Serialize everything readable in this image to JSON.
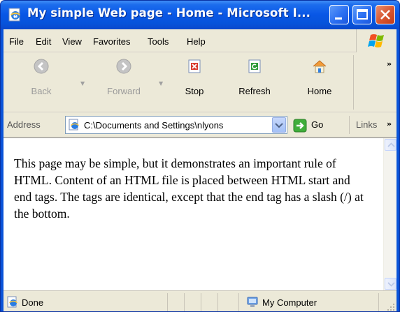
{
  "window": {
    "title": "My simple Web page - Home - Microsoft I..."
  },
  "menu": {
    "items": [
      "File",
      "Edit",
      "View",
      "Favorites",
      "Tools",
      "Help"
    ]
  },
  "toolbar": {
    "back_label": "Back",
    "forward_label": "Forward",
    "stop_label": "Stop",
    "refresh_label": "Refresh",
    "home_label": "Home",
    "overflow": "»"
  },
  "address": {
    "label": "Address",
    "value": "C:\\Documents and Settings\\nlyons",
    "go_label": "Go",
    "links_label": "Links",
    "links_overflow": "»"
  },
  "page": {
    "body_text": "This page may be simple, but it demonstrates an important rule of HTML. Content of an HTML file is placed between HTML start and end tags. The tags are identical, except that the end tag has a slash (/) at the bottom."
  },
  "status": {
    "text": "Done",
    "zone": "My Computer"
  },
  "colors": {
    "title_bar": "#0957e6",
    "chrome": "#ece9d8",
    "close_button": "#d7542f"
  },
  "icons": {
    "app": "ie-page-icon",
    "back": "back-arrow-icon",
    "forward": "forward-arrow-icon",
    "stop": "stop-icon",
    "refresh": "refresh-icon",
    "home": "home-icon",
    "go": "go-arrow-icon",
    "status": "ie-page-icon",
    "zone": "my-computer-icon"
  }
}
